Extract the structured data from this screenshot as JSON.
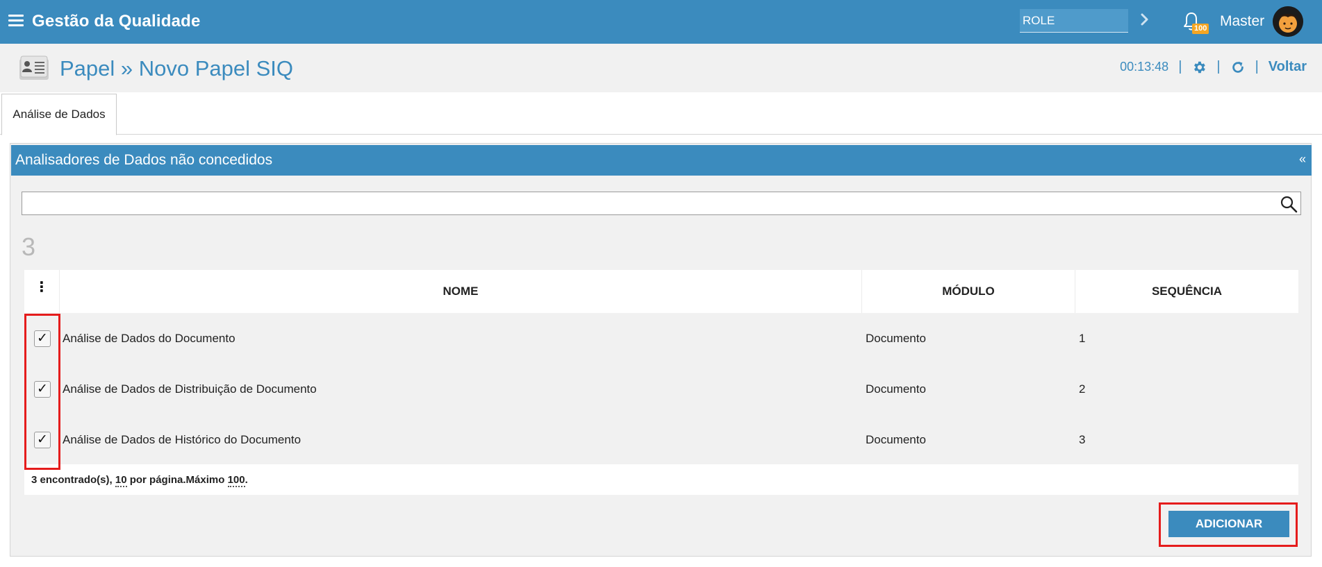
{
  "topbar": {
    "app_title": "Gestão da Qualidade",
    "role_value": "ROLE",
    "notification_count": "100",
    "user_name": "Master"
  },
  "header": {
    "breadcrumb": "Papel » Novo Papel SIQ",
    "timer": "00:13:48",
    "back_label": "Voltar"
  },
  "tabs": [
    {
      "label": "Análise de Dados",
      "active": true
    }
  ],
  "panel": {
    "title": "Analisadores de Dados não concedidos",
    "collapse_glyph": "«",
    "search_value": "",
    "count": "3",
    "table": {
      "columns": [
        "NOME",
        "MÓDULO",
        "SEQUÊNCIA"
      ],
      "rows": [
        {
          "checked": true,
          "nome": "Análise de Dados do Documento",
          "modulo": "Documento",
          "sequencia": "1"
        },
        {
          "checked": true,
          "nome": "Análise de Dados de Distribuição de Documento",
          "modulo": "Documento",
          "sequencia": "2"
        },
        {
          "checked": true,
          "nome": "Análise de Dados de Histórico do Documento",
          "modulo": "Documento",
          "sequencia": "3"
        }
      ],
      "footer": {
        "found_text": "3 encontrado(s), ",
        "per_page_value": "10",
        "per_page_text": " por página.Máximo ",
        "max_value": "100",
        "end": "."
      }
    },
    "add_button": "ADICIONAR"
  },
  "colors": {
    "primary": "#3b8bbe",
    "highlight_red": "#e51c1c",
    "badge": "#f5a623"
  },
  "icons": [
    "menu-icon",
    "chevron-right-icon",
    "bell-icon",
    "avatar",
    "page-icon",
    "gear-icon",
    "refresh-icon",
    "search-icon",
    "kebab-icon",
    "check-icon"
  ]
}
